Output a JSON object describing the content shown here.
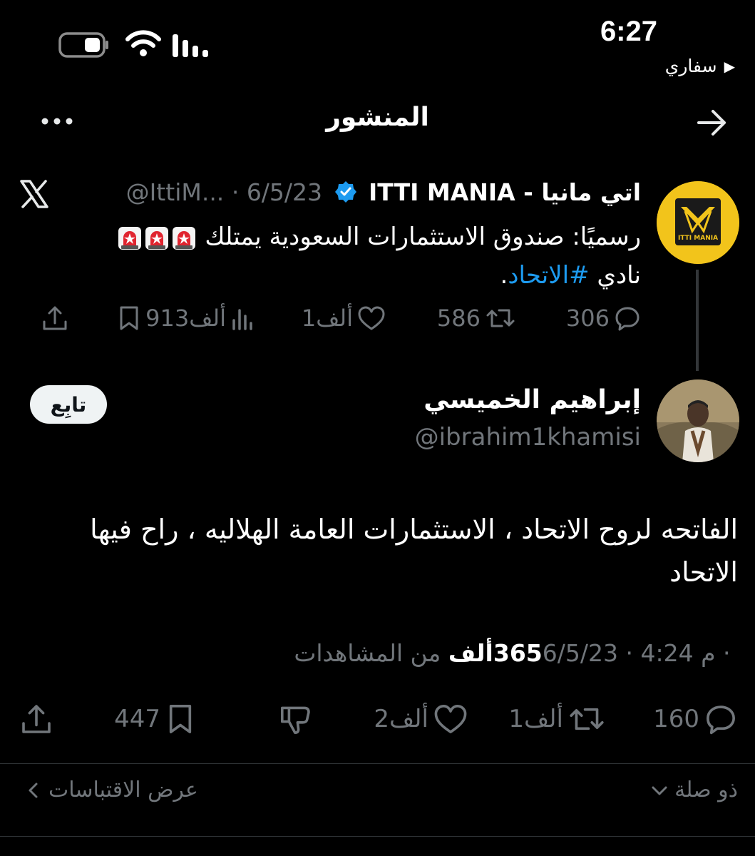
{
  "status_bar": {
    "time": "6:27",
    "back_app": "سفاري",
    "back_arrow": "▶"
  },
  "header": {
    "title": "المنشور"
  },
  "quoted": {
    "name": "اتي مانيا - ITTI MANIA",
    "handle": "@IttiM...",
    "date": "6/5/23",
    "sep": "·",
    "text_main": "رسميًا: صندوق الاستثمارات السعودية يمتلك",
    "text_line2_prefix": "نادي ",
    "hashtag": "#الاتحاد",
    "text_line2_suffix": ".",
    "avatar_text": "ITTI MANIA",
    "replies": "306",
    "reposts": "586",
    "likes": "1ألف",
    "views": "913ألف"
  },
  "main": {
    "name": "إبراهيم الخميسي",
    "handle": "@ibrahim1khamisi",
    "follow": "تابِع",
    "text": "الفاتحه لروح الاتحاد ، الاستثمارات العامة الهلاليه ، راح فيها الاتحاد",
    "date": "6/5/23",
    "time": "4:24 م",
    "views_count": "365ألف",
    "views_label": "من المشاهدات",
    "replies": "160",
    "reposts": "1ألف",
    "likes": "2ألف",
    "bookmarks": "447"
  },
  "footer": {
    "relevant": "ذو صلة",
    "quotes": "عرض الاقتباسات"
  },
  "colors": {
    "background": "#000000",
    "accent": "#1d9bf0",
    "muted": "#71767b",
    "text": "#e7e9ea",
    "verified": "#1d9bf0"
  }
}
